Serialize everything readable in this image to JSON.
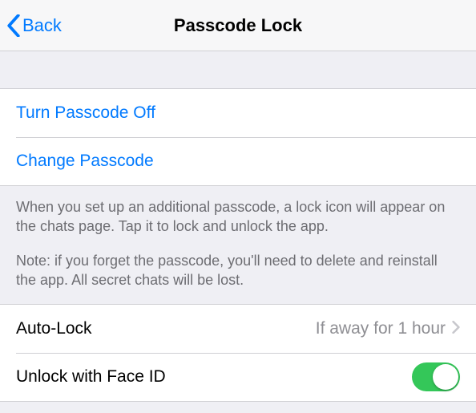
{
  "nav": {
    "back_label": "Back",
    "title": "Passcode Lock"
  },
  "passcode_group": {
    "turn_off_label": "Turn Passcode Off",
    "change_label": "Change Passcode"
  },
  "footer": {
    "p1": "When you set up an additional passcode, a lock icon will appear on the chats page. Tap it to lock and unlock the app.",
    "p2": "Note: if you forget the passcode, you'll need to delete and reinstall the app. All secret chats will be lost."
  },
  "options": {
    "auto_lock_label": "Auto-Lock",
    "auto_lock_value": "If away for 1 hour",
    "face_id_label": "Unlock with Face ID",
    "face_id_on": true
  }
}
